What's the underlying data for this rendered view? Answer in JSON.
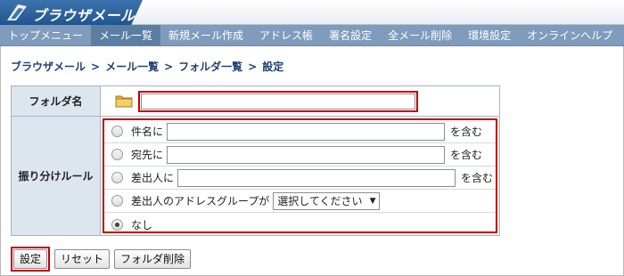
{
  "app": {
    "title": "ブラウザメール"
  },
  "nav": {
    "items": [
      {
        "label": "トップメニュー",
        "active": false
      },
      {
        "label": "メール一覧",
        "active": true
      },
      {
        "label": "新規メール作成",
        "active": false
      },
      {
        "label": "アドレス帳",
        "active": false
      },
      {
        "label": "署名設定",
        "active": false
      },
      {
        "label": "全メール削除",
        "active": false
      },
      {
        "label": "環境設定",
        "active": false
      },
      {
        "label": "オンラインヘルプ",
        "active": false
      }
    ]
  },
  "breadcrumb": {
    "items": [
      "ブラウザメール",
      "メール一覧",
      "フォルダ一覧",
      "設定"
    ],
    "separator": ">"
  },
  "form": {
    "folder_name_label": "フォルダ名",
    "folder_name_value": "",
    "rules_label": "振り分けルール",
    "rules": {
      "subject_label": "件名に",
      "subject_suffix": "を含む",
      "to_label": "宛先に",
      "to_suffix": "を含む",
      "from_label": "差出人に",
      "from_suffix": "を含む",
      "group_label": "差出人のアドレスグループが",
      "group_select_value": "選択してください",
      "none_label": "なし",
      "selected": "none"
    }
  },
  "buttons": {
    "set_label": "設定",
    "reset_label": "リセット",
    "delete_label": "フォルダ削除"
  },
  "colors": {
    "nav_bg": "#7f9cbd",
    "nav_active": "#5d7ea3",
    "label_bg": "#dde5ef",
    "highlight": "#c00000",
    "breadcrumb": "#1f3f73"
  }
}
